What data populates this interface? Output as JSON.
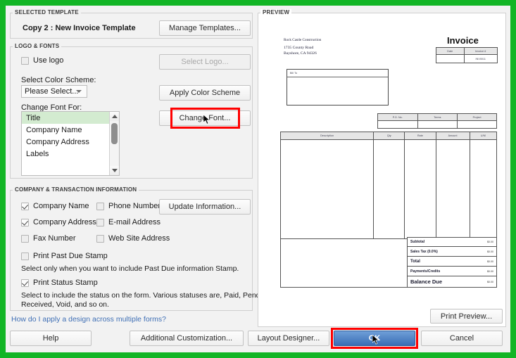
{
  "window": {
    "accent_green": "#12b525",
    "highlight_red": "#ff0000",
    "primary_blue": "#3a6db5",
    "selection_green": "#d3ebd0"
  },
  "selected_template": {
    "group_title": "SELECTED TEMPLATE",
    "template_name": "Copy 2 : New Invoice Template",
    "manage_button": "Manage Templates..."
  },
  "logo_fonts": {
    "group_title": "LOGO & FONTS",
    "use_logo_label": "Use logo",
    "use_logo_checked": false,
    "select_logo_button": "Select Logo...",
    "select_logo_disabled": true,
    "color_scheme_label": "Select Color Scheme:",
    "color_scheme_value": "Please Select...",
    "apply_color_button": "Apply Color Scheme",
    "change_font_for_label": "Change Font For:",
    "change_font_button": "Change Font...",
    "font_list": [
      {
        "label": "Title",
        "selected": true
      },
      {
        "label": "Company Name",
        "selected": false
      },
      {
        "label": "Company Address",
        "selected": false
      },
      {
        "label": "Labels",
        "selected": false
      }
    ]
  },
  "company_info": {
    "group_title": "COMPANY & TRANSACTION INFORMATION",
    "update_button": "Update Information...",
    "checkboxes": [
      {
        "label": "Company Name",
        "checked": true
      },
      {
        "label": "Phone Number",
        "checked": false
      },
      {
        "label": "Company Address",
        "checked": true
      },
      {
        "label": "E-mail Address",
        "checked": false
      },
      {
        "label": "Fax Number",
        "checked": false
      },
      {
        "label": "Web Site Address",
        "checked": false
      }
    ],
    "past_due_label": "Print Past Due Stamp",
    "past_due_checked": false,
    "past_due_help": "Select only when you want to include Past Due information Stamp.",
    "status_stamp_label": "Print Status Stamp",
    "status_stamp_checked": true,
    "status_stamp_help_1": "Select to include the status on the form. Various statuses are, Paid, Pending,",
    "status_stamp_help_2": "Received, Void, and so on."
  },
  "help_link": "How do I apply a design across multiple forms?",
  "footer": {
    "help": "Help",
    "additional_customization": "Additional Customization...",
    "layout_designer": "Layout Designer...",
    "ok": "OK",
    "cancel": "Cancel"
  },
  "preview": {
    "group_title": "PREVIEW",
    "print_preview_button": "Print Preview...",
    "document": {
      "company_name": "Rock Castle Construction",
      "address_line_1": "1735 County Road",
      "address_line_2": "Bayshore, CA 94326",
      "title": "Invoice",
      "meta_headers": [
        "Date",
        "Invoice #"
      ],
      "meta_values": [
        "",
        "INV0011"
      ],
      "bill_to_label": "Bill To",
      "ref_headers": [
        "P.O. No.",
        "Terms",
        "Project"
      ],
      "line_headers": [
        "Description",
        "Qty",
        "Rate",
        "Amount",
        "U/M"
      ],
      "totals": [
        {
          "label": "Subtotal",
          "value": "$0.00"
        },
        {
          "label": "Sales Tax  (0.0%)",
          "value": "$0.00"
        },
        {
          "label": "Total",
          "value": "$0.00"
        },
        {
          "label": "Payments/Credits",
          "value": "$0.00"
        },
        {
          "label": "Balance Due",
          "value": "$0.00"
        }
      ]
    }
  }
}
